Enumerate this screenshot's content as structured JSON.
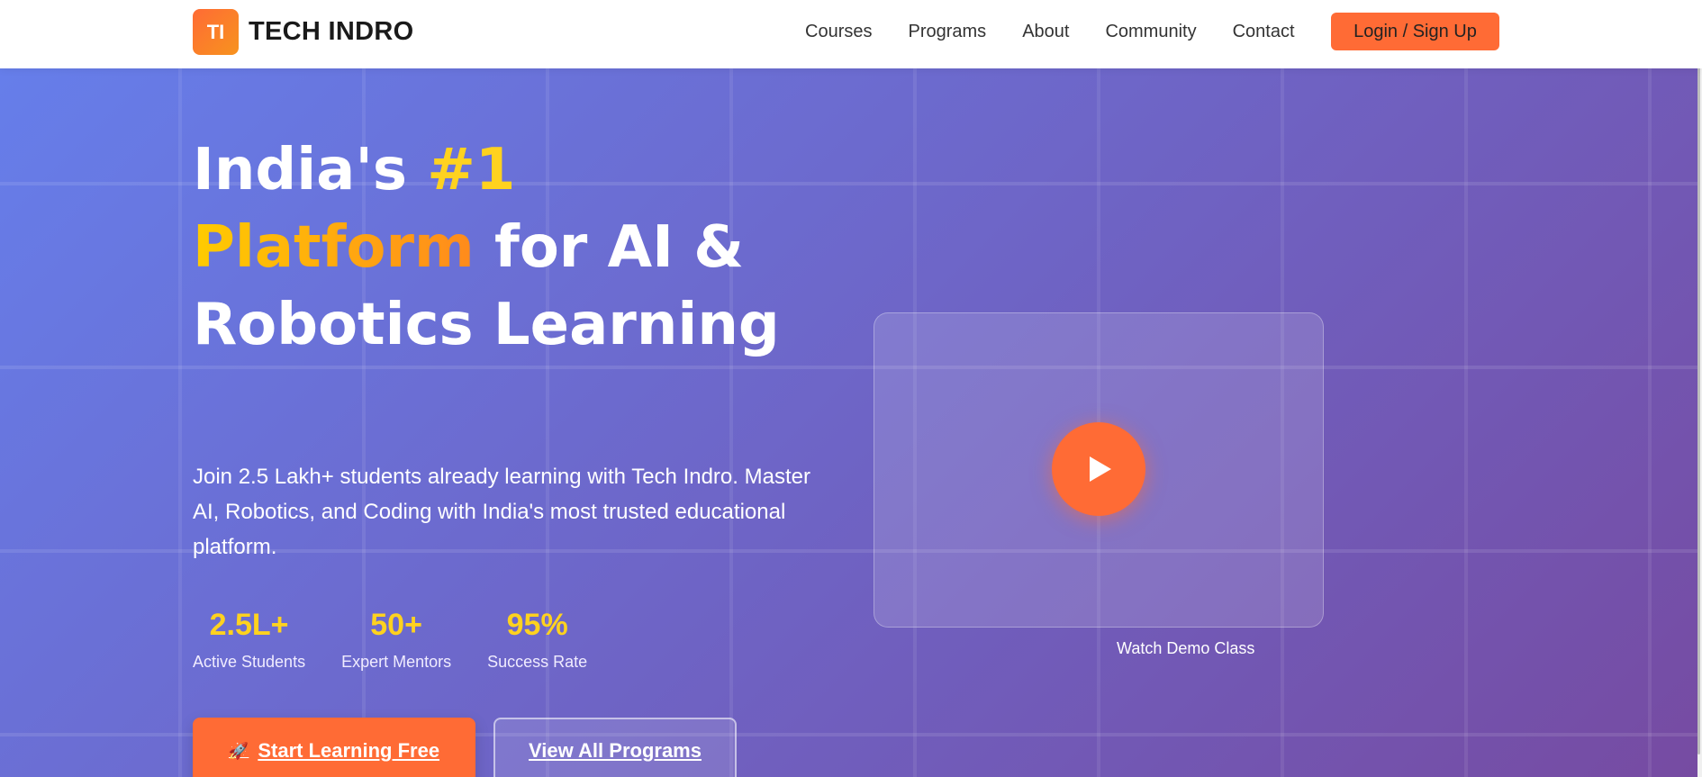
{
  "brand": {
    "mark": "TI",
    "name": "TECH INDRO",
    "accent": "#ff6b35",
    "highlight": "#ffd21f"
  },
  "nav": {
    "items": [
      "Courses",
      "Programs",
      "About",
      "Community",
      "Contact"
    ],
    "login_label": "Login / Sign Up"
  },
  "hero": {
    "title_part1": "India's ",
    "title_highlight1": "#1",
    "title_highlight2": "Platform",
    "title_part2": " for AI & Robotics Learning",
    "subtext": "Join 2.5 Lakh+ students already learning with Tech Indro. Master AI, Robotics, and Coding with India's most trusted educational platform.",
    "stats": [
      {
        "value": "2.5L+",
        "label": "Active Students"
      },
      {
        "value": "50+",
        "label": "Expert Mentors"
      },
      {
        "value": "95%",
        "label": "Success Rate"
      }
    ],
    "primary_cta": "Start Learning Free",
    "primary_cta_icon": "rocket-icon",
    "secondary_cta": "View All Programs",
    "video_caption": "Watch Demo Class",
    "video_icon": "play-icon",
    "gradient": [
      "#667eea",
      "#764ba2"
    ]
  }
}
